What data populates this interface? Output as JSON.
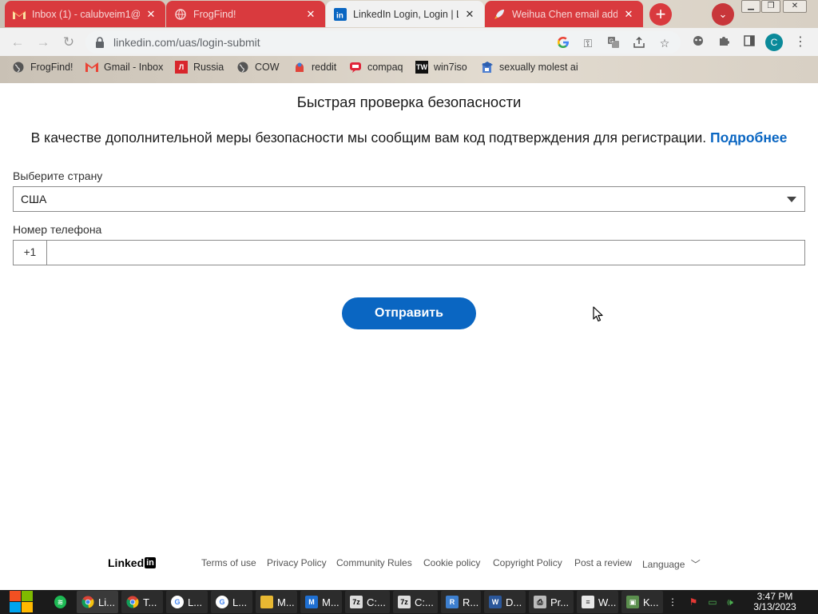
{
  "browser": {
    "tabs": [
      {
        "title": "Inbox (1) - calubveim1@",
        "icon": "gmail-icon",
        "active": false
      },
      {
        "title": "FrogFind!",
        "icon": "globe-icon",
        "active": false
      },
      {
        "title": "LinkedIn Login, Login | L",
        "icon": "linkedin-icon",
        "active": true
      },
      {
        "title": "Weihua Chen email add",
        "icon": "rocket-icon",
        "active": false
      }
    ],
    "new_tab_label": "+",
    "tab_search_label": "⌄",
    "url": "linkedin.com/uas/login-submit",
    "profile_initial": "C",
    "bookmarks": [
      {
        "label": "FrogFind!",
        "icon": "globe-icon"
      },
      {
        "label": "Gmail - Inbox",
        "icon": "gmail-icon"
      },
      {
        "label": "Russia",
        "icon": "ru-icon"
      },
      {
        "label": "COW",
        "icon": "globe-icon"
      },
      {
        "label": "reddit",
        "icon": "reddit-icon"
      },
      {
        "label": "compaq",
        "icon": "compaq-icon"
      },
      {
        "label": "win7iso",
        "icon": "tw-icon"
      },
      {
        "label": "sexually molest ai",
        "icon": "academic-icon"
      }
    ]
  },
  "page": {
    "title": "Быстрая проверка безопасности",
    "description": "В качестве дополнительной меры безопасности мы сообщим вам код подтверждения для регистрации.",
    "learn_more": "Подробнее",
    "country_label": "Выберите страну",
    "country_value": "США",
    "phone_label": "Номер телефона",
    "phone_prefix": "+1",
    "phone_value": "",
    "submit_label": "Отправить"
  },
  "footer": {
    "logo_text": "Linked",
    "logo_in": "in",
    "links": [
      "Terms of use",
      "Privacy Policy",
      "Community Rules",
      "Cookie policy",
      "Copyright Policy",
      "Post a review"
    ],
    "language_label": "Language"
  },
  "taskbar": {
    "apps": [
      {
        "label": "Li...",
        "icon": "chrome-icon"
      },
      {
        "label": "T...",
        "icon": "chrome-icon"
      },
      {
        "label": "L...",
        "icon": "google-icon"
      },
      {
        "label": "L...",
        "icon": "google-icon"
      },
      {
        "label": "M...",
        "icon": "folder-icon"
      },
      {
        "label": "M...",
        "icon": "malwarebytes-icon"
      },
      {
        "label": "C:...",
        "icon": "7zip-icon"
      },
      {
        "label": "C:...",
        "icon": "7zip-icon"
      },
      {
        "label": "R...",
        "icon": "regedit-icon"
      },
      {
        "label": "D...",
        "icon": "word-icon"
      },
      {
        "label": "Pr...",
        "icon": "printer-icon"
      },
      {
        "label": "W...",
        "icon": "notepad-icon"
      },
      {
        "label": "K...",
        "icon": "remote-desktop-icon"
      }
    ],
    "time": "3:47 PM",
    "date": "3/13/2023"
  },
  "colors": {
    "tab_red": "#d93a3e",
    "linkedin_blue": "#0a66c2"
  }
}
